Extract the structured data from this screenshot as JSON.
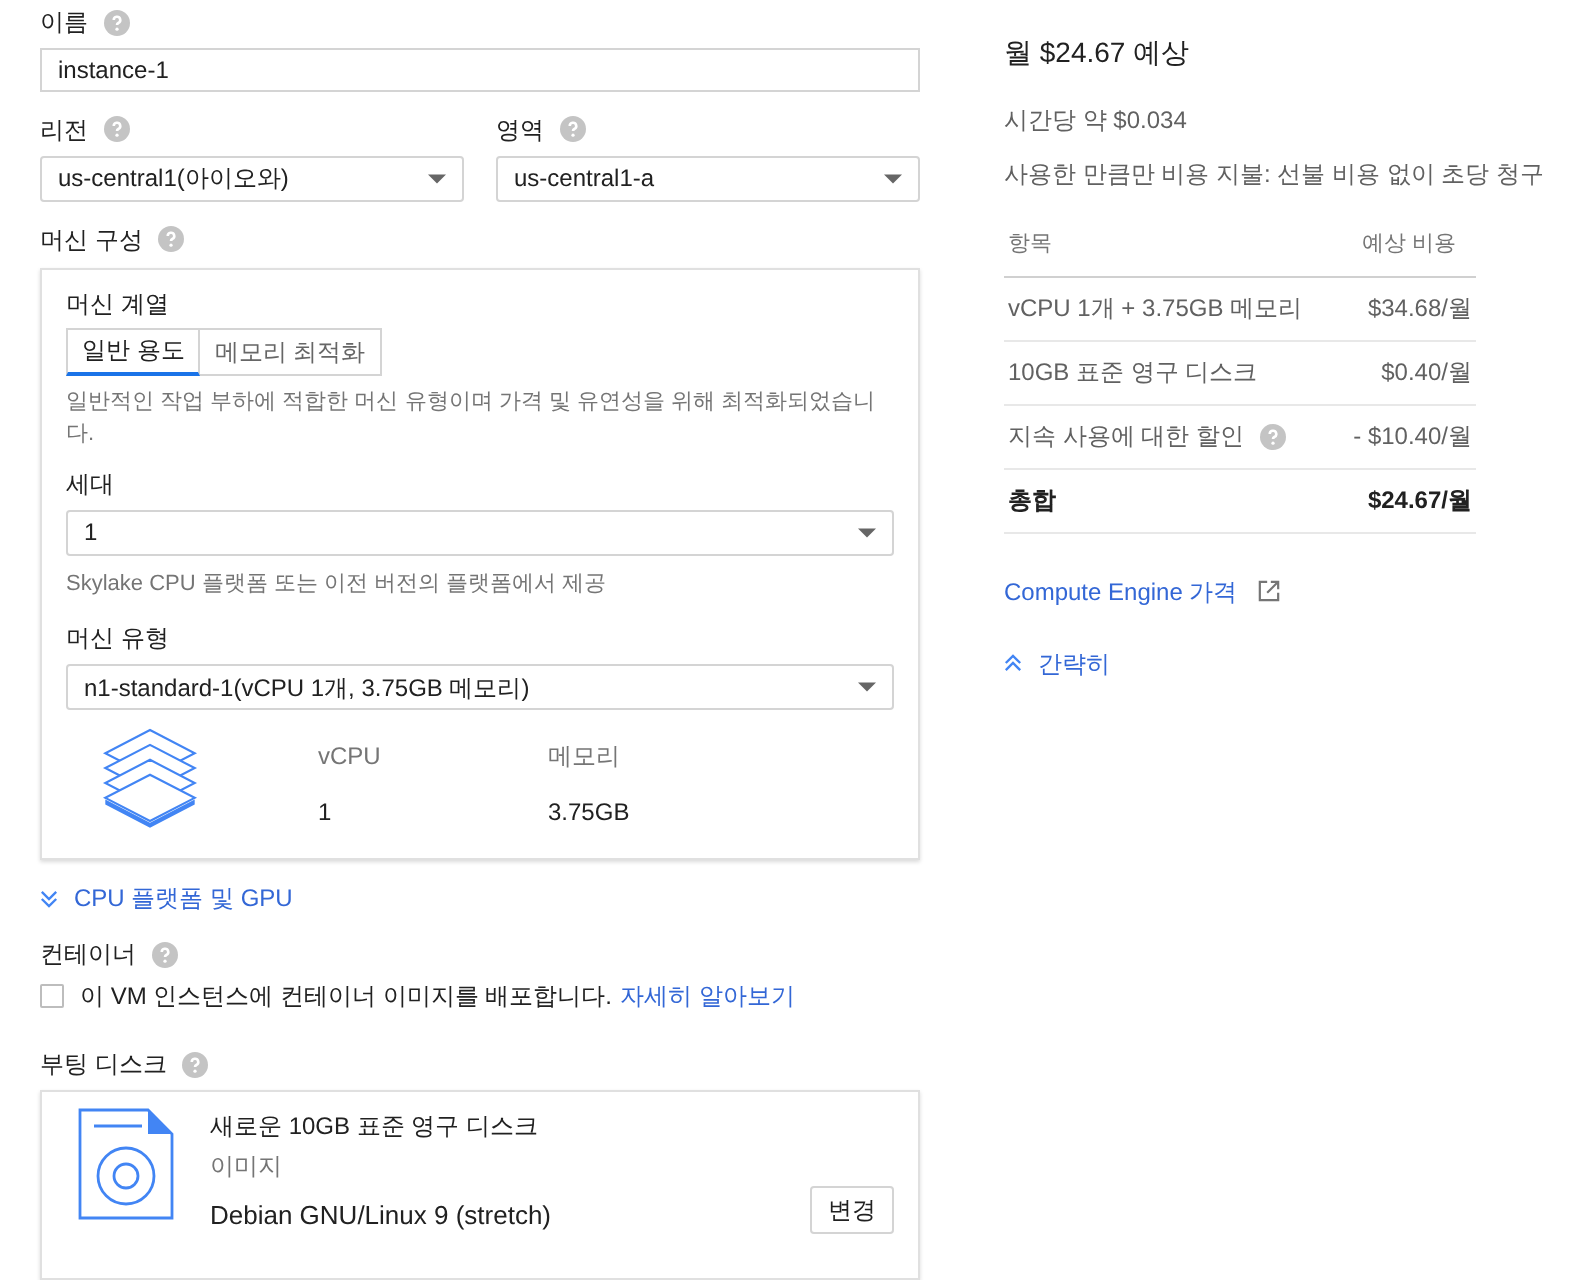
{
  "name_field": {
    "label": "이름",
    "value": "instance-1"
  },
  "region": {
    "label": "리전",
    "value": "us-central1(아이오와)"
  },
  "zone": {
    "label": "영역",
    "value": "us-central1-a"
  },
  "machine_config": {
    "label": "머신 구성",
    "family_label": "머신 계열",
    "tabs": [
      {
        "label": "일반 용도",
        "selected": true
      },
      {
        "label": "메모리 최적화",
        "selected": false
      }
    ],
    "description": "일반적인 작업 부하에 적합한 머신 유형이며 가격 및 유연성을 위해 최적화되었습니다.",
    "generation": {
      "label": "세대",
      "value": "1",
      "hint": "Skylake CPU 플랫폼 또는 이전 버전의 플랫폼에서 제공"
    },
    "machine_type": {
      "label": "머신 유형",
      "value": "n1-standard-1(vCPU 1개, 3.75GB 메모리)"
    },
    "specs": [
      {
        "name": "vCPU",
        "value": "1"
      },
      {
        "name": "메모리",
        "value": "3.75GB"
      }
    ]
  },
  "cpu_platform_link": "CPU 플랫폼 및 GPU",
  "container": {
    "label": "컨테이너",
    "checked": false,
    "text": "이 VM 인스턴스에 컨테이너 이미지를 배포합니다.",
    "link": "자세히 알아보기"
  },
  "boot_disk": {
    "label": "부팅 디스크",
    "title": "새로운 10GB 표준 영구 디스크",
    "image_label": "이미지",
    "image": "Debian GNU/Linux 9 (stretch)",
    "button": "변경"
  },
  "estimate": {
    "title": "월 $24.67 예상",
    "hourly": "시간당 약 $0.034",
    "note": "사용한 만큼만 비용 지불: 선불 비용 없이 초당 청구",
    "columns": [
      "항목",
      "예상 비용"
    ],
    "rows": [
      {
        "item": "vCPU 1개 + 3.75GB 메모리",
        "cost": "$34.68/월",
        "help": false,
        "total": false
      },
      {
        "item": "10GB 표준 영구 디스크",
        "cost": "$0.40/월",
        "help": false,
        "total": false
      },
      {
        "item": "지속 사용에 대한 할인",
        "cost": "- $10.40/월",
        "help": true,
        "total": false
      },
      {
        "item": "총합",
        "cost": "$24.67/월",
        "help": false,
        "total": true
      }
    ],
    "pricing_link": "Compute Engine 가격",
    "collapse_link": "간략히"
  }
}
